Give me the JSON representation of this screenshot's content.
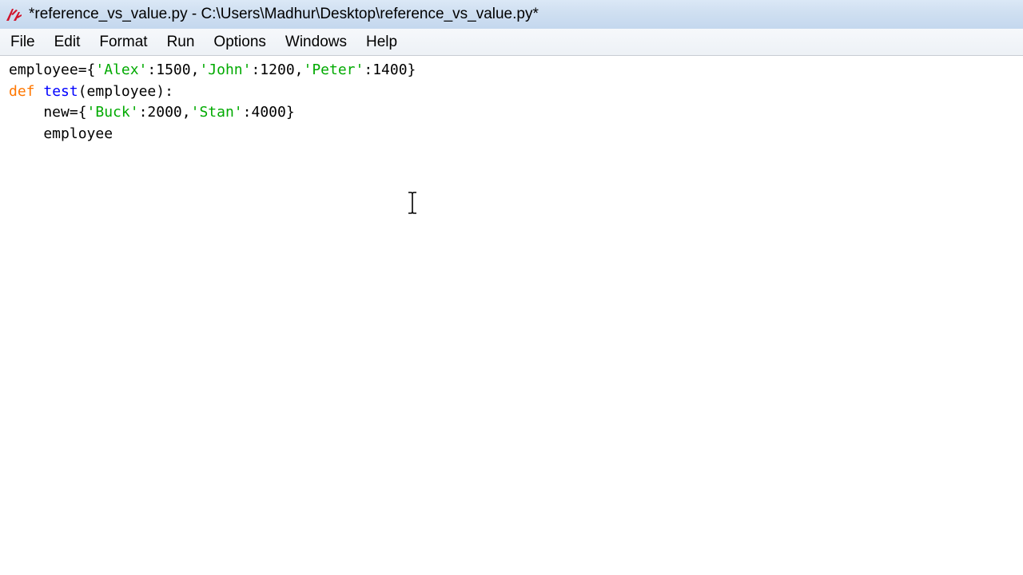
{
  "window": {
    "title": "*reference_vs_value.py - C:\\Users\\Madhur\\Desktop\\reference_vs_value.py*",
    "icon": "tk-feather-icon",
    "accent_color": "#cfdff1"
  },
  "menu": {
    "items": [
      "File",
      "Edit",
      "Format",
      "Run",
      "Options",
      "Windows",
      "Help"
    ]
  },
  "editor": {
    "lines": [
      [
        {
          "t": "plain",
          "s": "employee={"
        },
        {
          "t": "str",
          "s": "'Alex'"
        },
        {
          "t": "plain",
          "s": ":1500,"
        },
        {
          "t": "str",
          "s": "'John'"
        },
        {
          "t": "plain",
          "s": ":1200,"
        },
        {
          "t": "str",
          "s": "'Peter'"
        },
        {
          "t": "plain",
          "s": ":1400}"
        }
      ],
      [
        {
          "t": "kw",
          "s": "def"
        },
        {
          "t": "plain",
          "s": " "
        },
        {
          "t": "def",
          "s": "test"
        },
        {
          "t": "plain",
          "s": "(employee):"
        }
      ],
      [
        {
          "t": "plain",
          "s": "    new={"
        },
        {
          "t": "str",
          "s": "'Buck'"
        },
        {
          "t": "plain",
          "s": ":2000,"
        },
        {
          "t": "str",
          "s": "'Stan'"
        },
        {
          "t": "plain",
          "s": ":4000}"
        }
      ],
      [
        {
          "t": "plain",
          "s": "    employee"
        }
      ]
    ],
    "colors": {
      "string": "#00aa00",
      "keyword": "#ff7700",
      "definition": "#0000ff",
      "default": "#000000"
    },
    "pointer": "i-beam-cursor"
  }
}
